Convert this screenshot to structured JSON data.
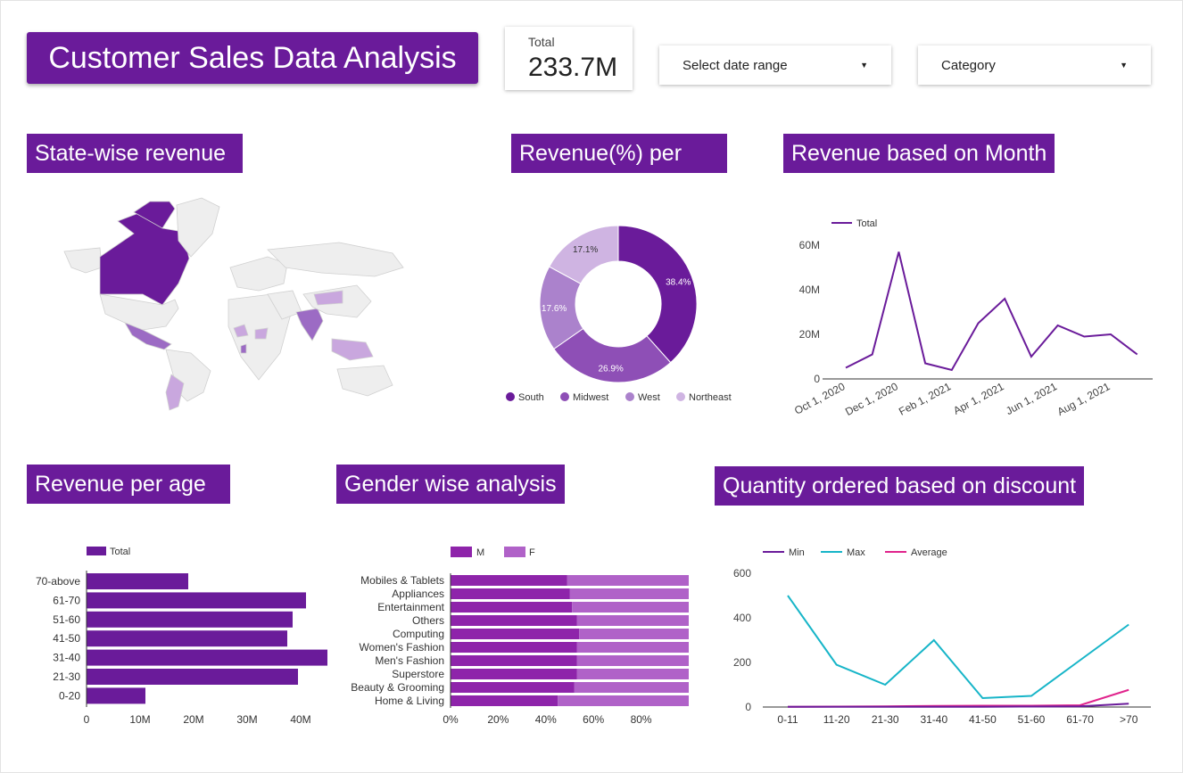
{
  "header": {
    "title": "Customer Sales Data Analysis",
    "scorecard": {
      "label": "Total",
      "value": "233.7M"
    },
    "date_filter": {
      "label": "Select date range"
    },
    "category_filter": {
      "label": "Category"
    }
  },
  "sections": {
    "map": "State-wise revenue",
    "pie": "Revenue(%) per",
    "month": "Revenue based on Month",
    "age": "Revenue per age",
    "gender": "Gender wise analysis",
    "discount": "Quantity ordered based on discount"
  },
  "colors": {
    "accent": "#6a1b9a",
    "map_land": "#eeeeee",
    "map_high": "#6a1b9a",
    "map_mid": "#9c6bc4",
    "map_low": "#c9a7de",
    "south": "#6a1b9a",
    "midwest": "#8e4fb6",
    "west": "#ab82cc",
    "northeast": "#cfb4e2",
    "gender_m": "#8e24aa",
    "gender_f": "#b062c8",
    "line_min": "#6a1b9a",
    "line_max": "#17b5c8",
    "line_avg": "#e0238c"
  },
  "chart_data": [
    {
      "type": "map",
      "title": "State-wise revenue",
      "highlighted_regions": [
        "Canada",
        "Greenland",
        "Mexico",
        "Argentina",
        "India",
        "Mongolia",
        "Sri Lanka"
      ]
    },
    {
      "type": "pie",
      "title": "Revenue(%) per",
      "donut": true,
      "slices": [
        {
          "label": "South",
          "value": 38.4,
          "text": "38.4%"
        },
        {
          "label": "Midwest",
          "value": 26.9,
          "text": "26.9%"
        },
        {
          "label": "West",
          "value": 17.6,
          "text": "17.6%"
        },
        {
          "label": "Northeast",
          "value": 17.1,
          "text": "17.1%"
        }
      ],
      "legend_position": "bottom"
    },
    {
      "type": "line",
      "title": "Revenue based on Month",
      "series": [
        {
          "name": "Total",
          "values": [
            5,
            11,
            57,
            7,
            4,
            25,
            36,
            10,
            24,
            19,
            20,
            11
          ]
        }
      ],
      "x": [
        "2020-10",
        "2020-11",
        "2020-12",
        "2021-01",
        "2021-02",
        "2021-03",
        "2021-04",
        "2021-05",
        "2021-06",
        "2021-07",
        "2021-08",
        "2021-09"
      ],
      "x_tick_labels": [
        "Oct 1, 2020",
        "Dec 1, 2020",
        "Feb 1, 2021",
        "Apr 1, 2021",
        "Jun 1, 2021",
        "Aug 1, 2021"
      ],
      "y_tick_labels": [
        "0",
        "20M",
        "40M",
        "60M"
      ],
      "y_unit": "M",
      "ylim": [
        0,
        60
      ],
      "legend_position": "top-left"
    },
    {
      "type": "bar",
      "orientation": "horizontal",
      "title": "Revenue per age",
      "categories": [
        "70-above",
        "61-70",
        "51-60",
        "41-50",
        "31-40",
        "21-30",
        "0-20"
      ],
      "series": [
        {
          "name": "Total",
          "values": [
            19,
            41,
            38.5,
            37.5,
            45,
            39.5,
            11
          ]
        }
      ],
      "x_tick_labels": [
        "0",
        "10M",
        "20M",
        "30M",
        "40M"
      ],
      "x_unit": "M",
      "xlim": [
        0,
        45
      ],
      "legend_position": "top-left"
    },
    {
      "type": "bar",
      "orientation": "horizontal",
      "stacked": "percent",
      "title": "Gender wise analysis",
      "categories": [
        "Mobiles & Tablets",
        "Appliances",
        "Entertainment",
        "Others",
        "Computing",
        "Women's Fashion",
        "Men's Fashion",
        "Superstore",
        "Beauty & Grooming",
        "Home & Living"
      ],
      "series": [
        {
          "name": "M",
          "values": [
            49,
            50,
            51,
            53,
            54,
            53,
            53,
            53,
            52,
            45
          ]
        },
        {
          "name": "F",
          "values": [
            51,
            50,
            49,
            47,
            46,
            47,
            47,
            47,
            48,
            55
          ]
        }
      ],
      "x_tick_labels": [
        "0%",
        "20%",
        "40%",
        "60%",
        "80%"
      ],
      "xlim": [
        0,
        100
      ],
      "legend_position": "top-left"
    },
    {
      "type": "line",
      "title": "Quantity ordered based on discount",
      "categories": [
        "0-11",
        "11-20",
        "21-30",
        "31-40",
        "41-50",
        "51-60",
        "61-70",
        ">70"
      ],
      "series": [
        {
          "name": "Min",
          "values": [
            1,
            1,
            1,
            1,
            1,
            2,
            3,
            15
          ]
        },
        {
          "name": "Max",
          "values": [
            500,
            190,
            100,
            300,
            40,
            50,
            210,
            370
          ]
        },
        {
          "name": "Average",
          "values": [
            1,
            2,
            3,
            5,
            6,
            6,
            8,
            77
          ]
        }
      ],
      "y_tick_labels": [
        "0",
        "200",
        "400",
        "600"
      ],
      "ylim": [
        0,
        600
      ],
      "legend_position": "top-left"
    }
  ]
}
